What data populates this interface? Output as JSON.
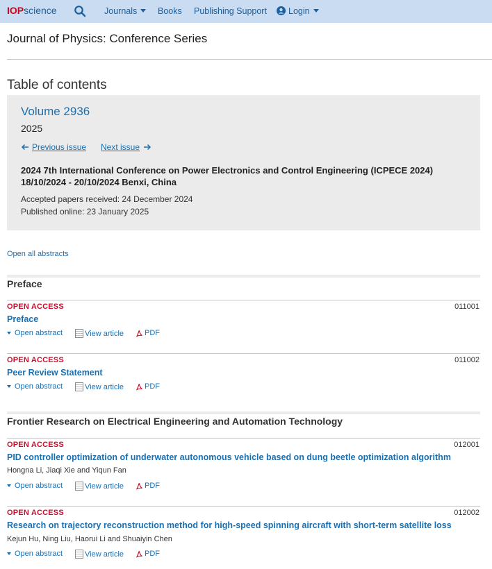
{
  "nav": {
    "logo_iop": "IOP",
    "logo_science": "science",
    "journals": "Journals",
    "books": "Books",
    "publishing_support": "Publishing Support",
    "login": "Login"
  },
  "journal_title": "Journal of Physics: Conference Series",
  "toc_title": "Table of contents",
  "volume": {
    "title": "Volume 2936",
    "year": "2025",
    "prev": "Previous issue",
    "next": "Next issue",
    "conference": "2024 7th International Conference on Power Electronics and Control Engineering (ICPECE 2024)",
    "dates": "18/10/2024 - 20/10/2024 Benxi, China",
    "accepted": "Accepted papers received: 24 December 2024",
    "published": "Published online: 23 January 2025"
  },
  "open_all": "Open all abstracts",
  "labels": {
    "open_access": "OPEN ACCESS",
    "open_abstract": "Open abstract",
    "view_article": "View article",
    "pdf": "PDF"
  },
  "sections": [
    {
      "title": "Preface",
      "articles": [
        {
          "number": "011001",
          "title": "Preface",
          "authors": ""
        },
        {
          "number": "011002",
          "title": "Peer Review Statement",
          "authors": ""
        }
      ]
    },
    {
      "title": "Frontier Research on Electrical Engineering and Automation Technology",
      "articles": [
        {
          "number": "012001",
          "title": "PID controller optimization of underwater autonomous vehicle based on dung beetle optimization algorithm",
          "authors": "Hongna Li, Jiaqi Xie and Yiqun Fan"
        },
        {
          "number": "012002",
          "title": "Research on trajectory reconstruction method for high-speed spinning aircraft with short-term satellite loss",
          "authors": "Kejun Hu, Ning Liu, Haorui Li and Shuaiyin Chen"
        }
      ]
    }
  ],
  "colors": {
    "nav_bg": "#c9dcf1",
    "link": "#1a6fb0",
    "open_access": "#c8102e",
    "panel_bg": "#ebebeb"
  }
}
